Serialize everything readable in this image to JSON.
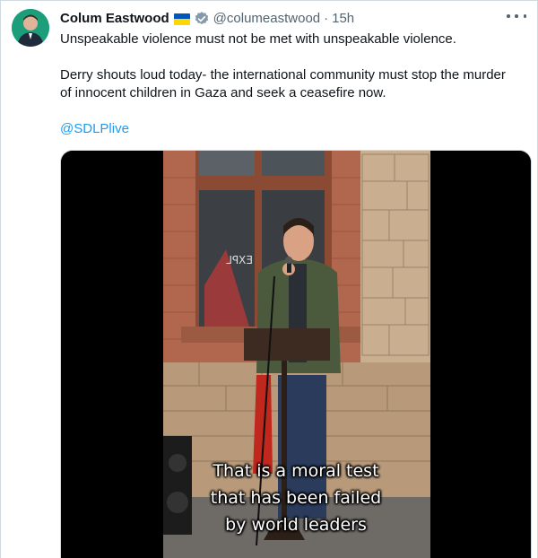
{
  "author": {
    "name": "Colum Eastwood",
    "handle": "@columeastwood",
    "separator": "·",
    "time": "15h",
    "flag_colors": [
      "#0057b7",
      "#ffd700"
    ],
    "verified_color": "#829aab",
    "avatar_bg": "#1d9e7a"
  },
  "tweet": {
    "line1": "Unspeakable violence must not be met with unspeakable violence.",
    "line2": "Derry shouts loud today- the international community must stop the murder of innocent children in Gaza and seek a ceasefire now.",
    "mention": "@SDLPlive"
  },
  "video": {
    "window_sign": "EXPL",
    "captions": [
      "That is a moral test",
      "that has been failed",
      "by world leaders"
    ]
  },
  "icons": {
    "more": "more-icon",
    "verified": "verified-icon",
    "flag": "ukraine-flag-icon"
  }
}
